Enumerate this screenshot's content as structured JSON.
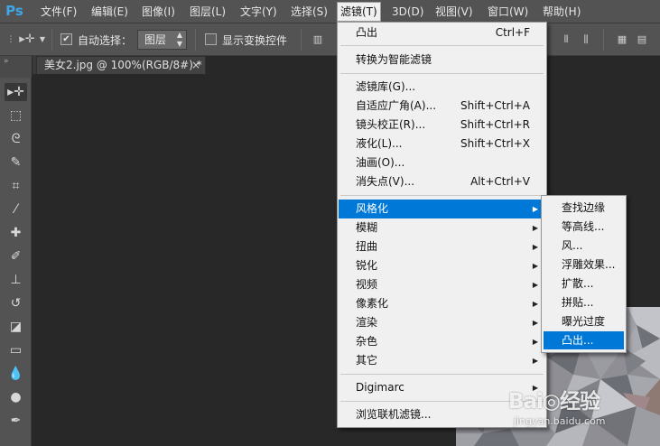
{
  "app": {
    "logo": "Ps"
  },
  "menubar": {
    "items": [
      "文件(F)",
      "编辑(E)",
      "图像(I)",
      "图层(L)",
      "文字(Y)",
      "选择(S)",
      "滤镜(T)",
      "3D(D)",
      "视图(V)",
      "窗口(W)",
      "帮助(H)"
    ],
    "active": "滤镜(T)"
  },
  "options": {
    "auto_select_checked": true,
    "auto_select_label": "自动选择：",
    "layer_select_value": "图层",
    "show_transform_checked": false,
    "show_transform_label": "显示变换控件"
  },
  "document": {
    "tab_title": "美女2.jpg @ 100%(RGB/8#) *",
    "close_glyph": "×"
  },
  "filter_menu": {
    "groups": [
      [
        {
          "label": "凸出",
          "shortcut": "Ctrl+F"
        }
      ],
      [
        {
          "label": "转换为智能滤镜"
        }
      ],
      [
        {
          "label": "滤镜库(G)..."
        },
        {
          "label": "自适应广角(A)...",
          "shortcut": "Shift+Ctrl+A"
        },
        {
          "label": "镜头校正(R)...",
          "shortcut": "Shift+Ctrl+R"
        },
        {
          "label": "液化(L)...",
          "shortcut": "Shift+Ctrl+X"
        },
        {
          "label": "油画(O)..."
        },
        {
          "label": "消失点(V)...",
          "shortcut": "Alt+Ctrl+V"
        }
      ],
      [
        {
          "label": "风格化",
          "submenu": true,
          "highlighted": true
        },
        {
          "label": "模糊",
          "submenu": true
        },
        {
          "label": "扭曲",
          "submenu": true
        },
        {
          "label": "锐化",
          "submenu": true
        },
        {
          "label": "视频",
          "submenu": true
        },
        {
          "label": "像素化",
          "submenu": true
        },
        {
          "label": "渲染",
          "submenu": true
        },
        {
          "label": "杂色",
          "submenu": true
        },
        {
          "label": "其它",
          "submenu": true
        }
      ],
      [
        {
          "label": "Digimarc",
          "submenu": true
        }
      ],
      [
        {
          "label": "浏览联机滤镜..."
        }
      ]
    ]
  },
  "stylize_submenu": {
    "items": [
      "查找边缘",
      "等高线...",
      "风...",
      "浮雕效果...",
      "扩散...",
      "拼贴...",
      "曝光过度",
      "凸出..."
    ],
    "highlighted": "凸出..."
  },
  "watermark": {
    "logo": "Bai◎经验",
    "url": "jingyan.baidu.com"
  },
  "colors": {
    "menu_highlight": "#0078d7",
    "ui_panel": "#535353",
    "canvas": "#282828",
    "ps_blue": "#3fa7e8"
  }
}
